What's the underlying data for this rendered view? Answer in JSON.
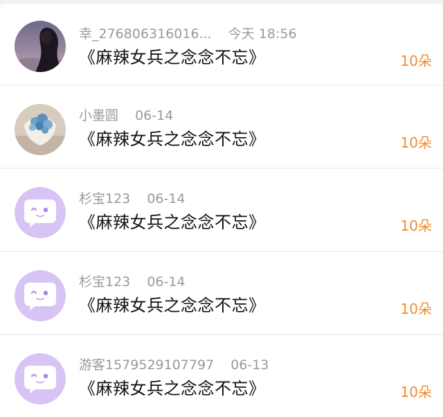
{
  "colors": {
    "gift_accent": "#f28a2b",
    "meta_gray": "#999999",
    "default_avatar_bg": "#d7c4f5"
  },
  "items": [
    {
      "avatar": "photo-woman-dusk",
      "name": "幸_276806316016...",
      "time": "今天 18:56",
      "title": "《麻辣女兵之念念不忘》",
      "gift": "10朵"
    },
    {
      "avatar": "photo-blue-bouquet",
      "name": "小墨圆",
      "time": "06-14",
      "title": "《麻辣女兵之念念不忘》",
      "gift": "10朵"
    },
    {
      "avatar": "default-chat-bubble-avatar",
      "name": "杉宝123",
      "time": "06-14",
      "title": "《麻辣女兵之念念不忘》",
      "gift": "10朵"
    },
    {
      "avatar": "default-chat-bubble-avatar",
      "name": "杉宝123",
      "time": "06-14",
      "title": "《麻辣女兵之念念不忘》",
      "gift": "10朵"
    },
    {
      "avatar": "default-chat-bubble-avatar",
      "name": "游客1579529107797",
      "time": "06-13",
      "title": "《麻辣女兵之念念不忘》",
      "gift": "10朵"
    }
  ]
}
